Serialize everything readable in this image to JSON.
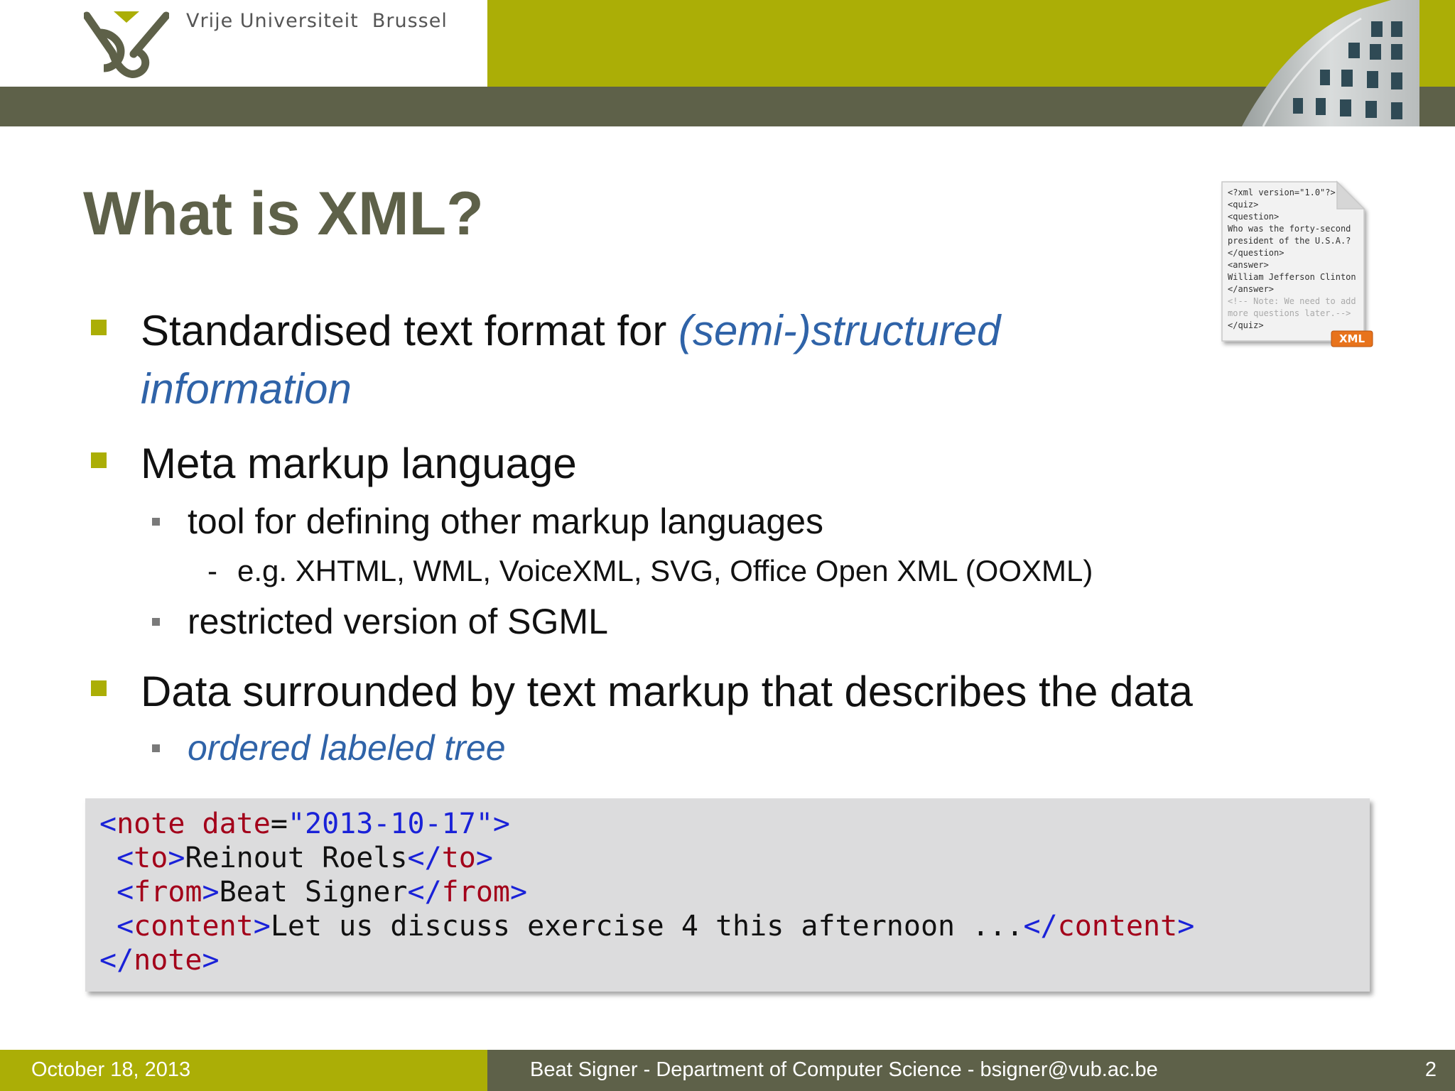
{
  "header": {
    "university_name": "Vrije Universiteit  Brussel",
    "logo": "vub-logo-icon",
    "photo": "building-photo-icon"
  },
  "slide": {
    "title": "What is XML?",
    "bullets": [
      {
        "prefix": "Standardised text format for ",
        "emphasis_line1": "(semi-)structured",
        "emphasis_line2": "information"
      },
      {
        "text": "Meta markup language",
        "sub": [
          {
            "text": "tool for defining other markup languages",
            "sub": [
              "e.g. XHTML, WML, VoiceXML, SVG, Office Open XML (OOXML)"
            ]
          },
          {
            "text": "restricted version of SGML"
          }
        ]
      },
      {
        "text": "Data surrounded by text markup that describes the data",
        "sub": [
          {
            "text": "ordered labeled tree"
          }
        ]
      }
    ],
    "xml_file_icon": {
      "lines": [
        "<?xml version=\"1.0\"?>",
        "<quiz>",
        " <question>",
        "  Who was the forty-second",
        "  president of the U.S.A.?",
        " </question>",
        " <answer>",
        "  William Jefferson Clinton",
        " </answer>",
        " <!-- Note: We need to add",
        "  more questions later.-->",
        "</quiz>"
      ],
      "badge": "XML"
    },
    "code": {
      "l1_open": "<",
      "l1_tag": "note",
      "l1_space": " ",
      "l1_attr": "date",
      "l1_eq": "=",
      "l1_value": "\"2013-10-17\"",
      "l1_close": ">",
      "l2_open": " <",
      "l2_tag": "to",
      "l2_gt": ">",
      "l2_text": "Reinout Roels",
      "l2_endopen": "</",
      "l2_endtag": "to",
      "l2_endgt": ">",
      "l3_open": " <",
      "l3_tag": "from",
      "l3_gt": ">",
      "l3_text": "Beat Signer",
      "l3_endopen": "</",
      "l3_endtag": "from",
      "l3_endgt": ">",
      "l4_open": " <",
      "l4_tag": "content",
      "l4_gt": ">",
      "l4_text": "Let us discuss exercise 4 this afternoon ...",
      "l4_endopen": "</",
      "l4_endtag": "content",
      "l4_endgt": ">",
      "l5_open": "</",
      "l5_tag": "note",
      "l5_gt": ">"
    }
  },
  "footer": {
    "date": "October 18, 2013",
    "author": "Beat Signer - Department of Computer Science - bsigner@vub.ac.be",
    "page": "2"
  },
  "colors": {
    "olive": "#abae06",
    "dark_olive": "#5e6149",
    "emphasis_blue": "#2f63a8",
    "code_tag_blue": "#1a22d8",
    "code_name_red": "#a3001a",
    "code_bg": "#dcdcdd"
  }
}
